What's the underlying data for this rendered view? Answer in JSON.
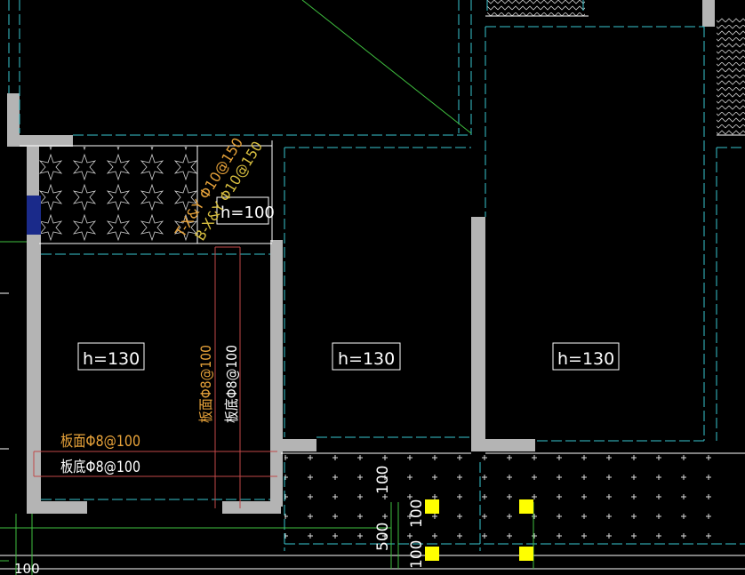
{
  "drawing": {
    "slab_thickness_labels": [
      "h=130",
      "h=130",
      "h=130"
    ],
    "slab_top_rebar": "板面Φ8@100",
    "slab_bottom_rebar": "板底Φ8@100",
    "slab_top_rebar_vertical": "板面Φ8@100",
    "slab_bottom_rebar_vertical": "板底Φ8@100",
    "diag_rebar_top": "T-X&Y Φ10@150",
    "diag_rebar_bottom": "B-X&Y Φ10@150",
    "sunken_slab_label": "h=100",
    "dim_100_a": "100",
    "dim_100_b": "100",
    "dim_500": "500",
    "dim_100_c": "100",
    "dim_100_left": "100"
  },
  "colors": {
    "background": "#000000",
    "wall": "#b4b4b4",
    "dashed": "#39c6d0",
    "green": "#3fbf3f",
    "white_line": "#ffffff",
    "orange_text": "#e8a33a",
    "yellow_text": "#d9c040",
    "column_fill": "#ffff00",
    "red_line": "#c04848",
    "blue_wall": "#1a2a8a"
  }
}
